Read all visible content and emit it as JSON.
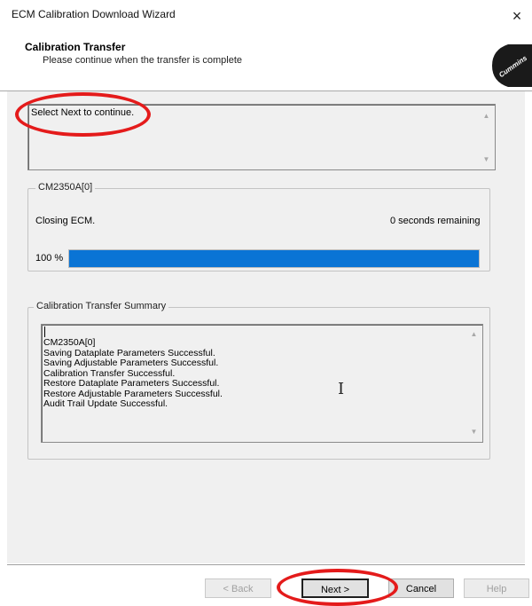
{
  "window": {
    "title": "ECM Calibration Download Wizard",
    "close_glyph": "×"
  },
  "header": {
    "title": "Calibration Transfer",
    "subtitle": "Please continue when the transfer is complete",
    "logo_text": "Cummins",
    "logo_icon": "cummins-logo"
  },
  "status": {
    "message": "Select Next to continue."
  },
  "ecm": {
    "group_label": "CM2350A[0]",
    "state": "Closing ECM.",
    "remaining": "0 seconds remaining",
    "progress_label": "100 %",
    "progress_value": 1.0,
    "progress_color": "#0a74d5"
  },
  "summary": {
    "group_label": "Calibration Transfer Summary",
    "lines": [
      "CM2350A[0]",
      "Saving Dataplate Parameters Successful.",
      "Saving Adjustable Parameters Successful.",
      "Calibration Transfer Successful.",
      "Restore Dataplate Parameters Successful.",
      "Restore Adjustable Parameters Successful.",
      "Audit Trail Update Successful."
    ]
  },
  "buttons": {
    "back": "< Back",
    "next": "Next >",
    "cancel": "Cancel",
    "help": "Help"
  },
  "scroll": {
    "up_glyph": "▲",
    "down_glyph": "▼"
  },
  "annotation_color": "#e41b1b"
}
